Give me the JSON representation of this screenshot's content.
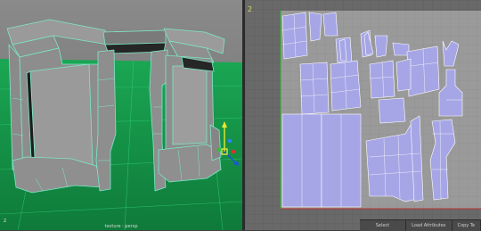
{
  "viewport": {
    "camera_label": "texture : persp",
    "axis_label": "z"
  },
  "uv_editor": {
    "panel_number": "2"
  },
  "buttons": {
    "select": "Select",
    "load_attributes": "Load Attributes",
    "copy": "Copy Te"
  },
  "colors": {
    "grid_floor": "#1cb25a",
    "mesh_face": "#8c8c8c",
    "wireframe": "#7de8c8",
    "uv_shell": "#a6a6e6",
    "uv_background": "#6a6a6a"
  }
}
